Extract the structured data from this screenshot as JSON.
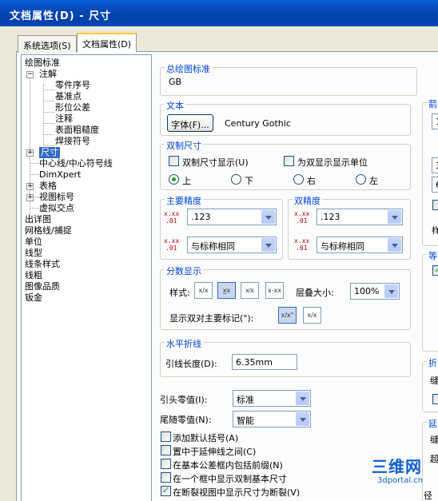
{
  "window": {
    "title": "文档属性(D) - 尺寸"
  },
  "tabs": [
    {
      "label": "系统选项(S)"
    },
    {
      "label": "文档属性(D)"
    }
  ],
  "tree": {
    "items": [
      {
        "label": "绘图标准"
      },
      {
        "label": "注解"
      },
      {
        "label": "零件序号"
      },
      {
        "label": "基准点"
      },
      {
        "label": "形位公差"
      },
      {
        "label": "注释"
      },
      {
        "label": "表面粗糙度"
      },
      {
        "label": "焊接符号"
      },
      {
        "label": "尺寸"
      },
      {
        "label": "中心线/中心符号线"
      },
      {
        "label": "DimXpert"
      },
      {
        "label": "表格"
      },
      {
        "label": "视图标号"
      },
      {
        "label": "虚拟交点"
      },
      {
        "label": "出详图"
      },
      {
        "label": "网格线/捕捉"
      },
      {
        "label": "单位"
      },
      {
        "label": "线型"
      },
      {
        "label": "线条样式"
      },
      {
        "label": "线粗"
      },
      {
        "label": "图像品质"
      },
      {
        "label": "钣金"
      }
    ]
  },
  "overall_standard": {
    "title": "总绘图标准",
    "value": "GB"
  },
  "text_group": {
    "title": "文本",
    "font_button": "字体(F)...",
    "font_name": "Century Gothic"
  },
  "dual_dim": {
    "title": "双制尺寸",
    "show_label": "双制尺寸显示(U)",
    "show_checked": false,
    "unit_label": "为双显示显示单位",
    "unit_checked": false,
    "positions": [
      {
        "label": "上",
        "selected": true
      },
      {
        "label": "下",
        "selected": false
      },
      {
        "label": "右",
        "selected": false
      },
      {
        "label": "左",
        "selected": false
      }
    ]
  },
  "primary_precision": {
    "title": "主要精度",
    "value1": ".123",
    "value2": "与标称相同"
  },
  "dual_precision": {
    "title": "双精度",
    "value1": ".123",
    "value2": "与标称相同"
  },
  "fraction": {
    "title": "分数显示",
    "style_label": "样式:",
    "stack_label": "层叠大小:",
    "stack_value": "100%",
    "show_marks_label": "显示双对主要标记(\"):"
  },
  "break_line": {
    "title": "水平折线",
    "length_label": "引线长度(D):",
    "length_value": "6.35mm"
  },
  "leading_zero": {
    "label": "引头零值(I):",
    "value": "标准"
  },
  "trailing_zero": {
    "label": "尾随零值(N):",
    "value": "智能"
  },
  "options": [
    {
      "label": "添加默认括号(A)",
      "checked": false
    },
    {
      "label": "置中于延伸线之间(C)",
      "checked": false
    },
    {
      "label": "在基本公差框内包括前缀(N)",
      "checked": false
    },
    {
      "label": "在一个框中显示双制基本尺寸",
      "checked": false
    },
    {
      "label": "在断裂视图中显示尺寸为断裂(V)",
      "checked": true
    }
  ],
  "right_partial": {
    "arrows_title": "箭",
    "row1": "1",
    "row2": "3",
    "row3": "6",
    "label_sample": "样",
    "group2_title": "等",
    "fold_title": "折",
    "fold_row": "缝",
    "ext_title": "延",
    "ext_row": "缝",
    "ext_row2": "超",
    "ext_row3": "径"
  },
  "watermark": {
    "brand": "三维网",
    "url": "3dportal.cn"
  },
  "colors": {
    "title_bar": "#0A5FD8",
    "group_title": "#0046D5",
    "selection": "#316AC5",
    "check": "#21A121"
  }
}
